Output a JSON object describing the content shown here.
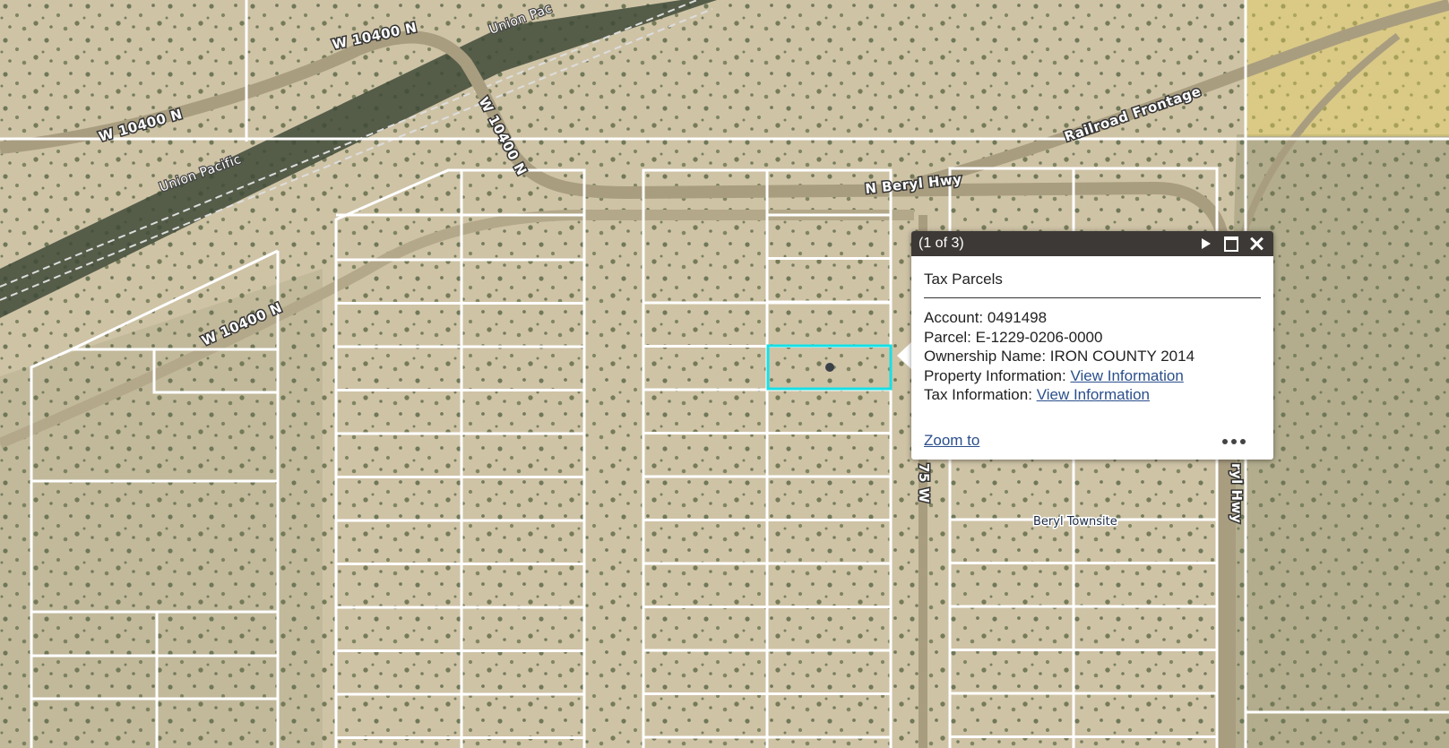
{
  "map": {
    "roads": {
      "w10400n_1": "W 10400 N",
      "w10400n_2": "W 10400 N",
      "w10400n_3": "W 10400 N",
      "w10400n_4": "W 10400 N",
      "n_beryl_hwy": "N Beryl Hwy",
      "railroad_frontage": "Railroad Frontage",
      "beryl_hwy_vertical": "ryl Hwy",
      "road_75w": "75 W"
    },
    "railroads": {
      "union_pacific_1": "Union Pacific",
      "union_pacific_2": "Union Pac"
    },
    "places": {
      "beryl_townsite": "Beryl Townsite"
    },
    "colors": {
      "highlight": "#16e0e6",
      "parcel_line": "#ffffff",
      "terrain": "#cfc3a6",
      "vegetation": "#5c6b4a",
      "road": "#a99d80"
    }
  },
  "popup": {
    "count": "(1 of 3)",
    "title": "Tax Parcels",
    "account_label": "Account:",
    "account_value": "0491498",
    "parcel_label": "Parcel:",
    "parcel_value": "E-1229-0206-0000",
    "owner_label": "Ownership Name:",
    "owner_value": "IRON COUNTY 2014",
    "property_label": "Property Information:",
    "property_link": "View Information",
    "tax_label": "Tax Information:",
    "tax_link": "View Information",
    "zoom_to": "Zoom to",
    "icons": [
      "next-icon",
      "maximize-icon",
      "close-icon",
      "more-options-icon"
    ]
  }
}
